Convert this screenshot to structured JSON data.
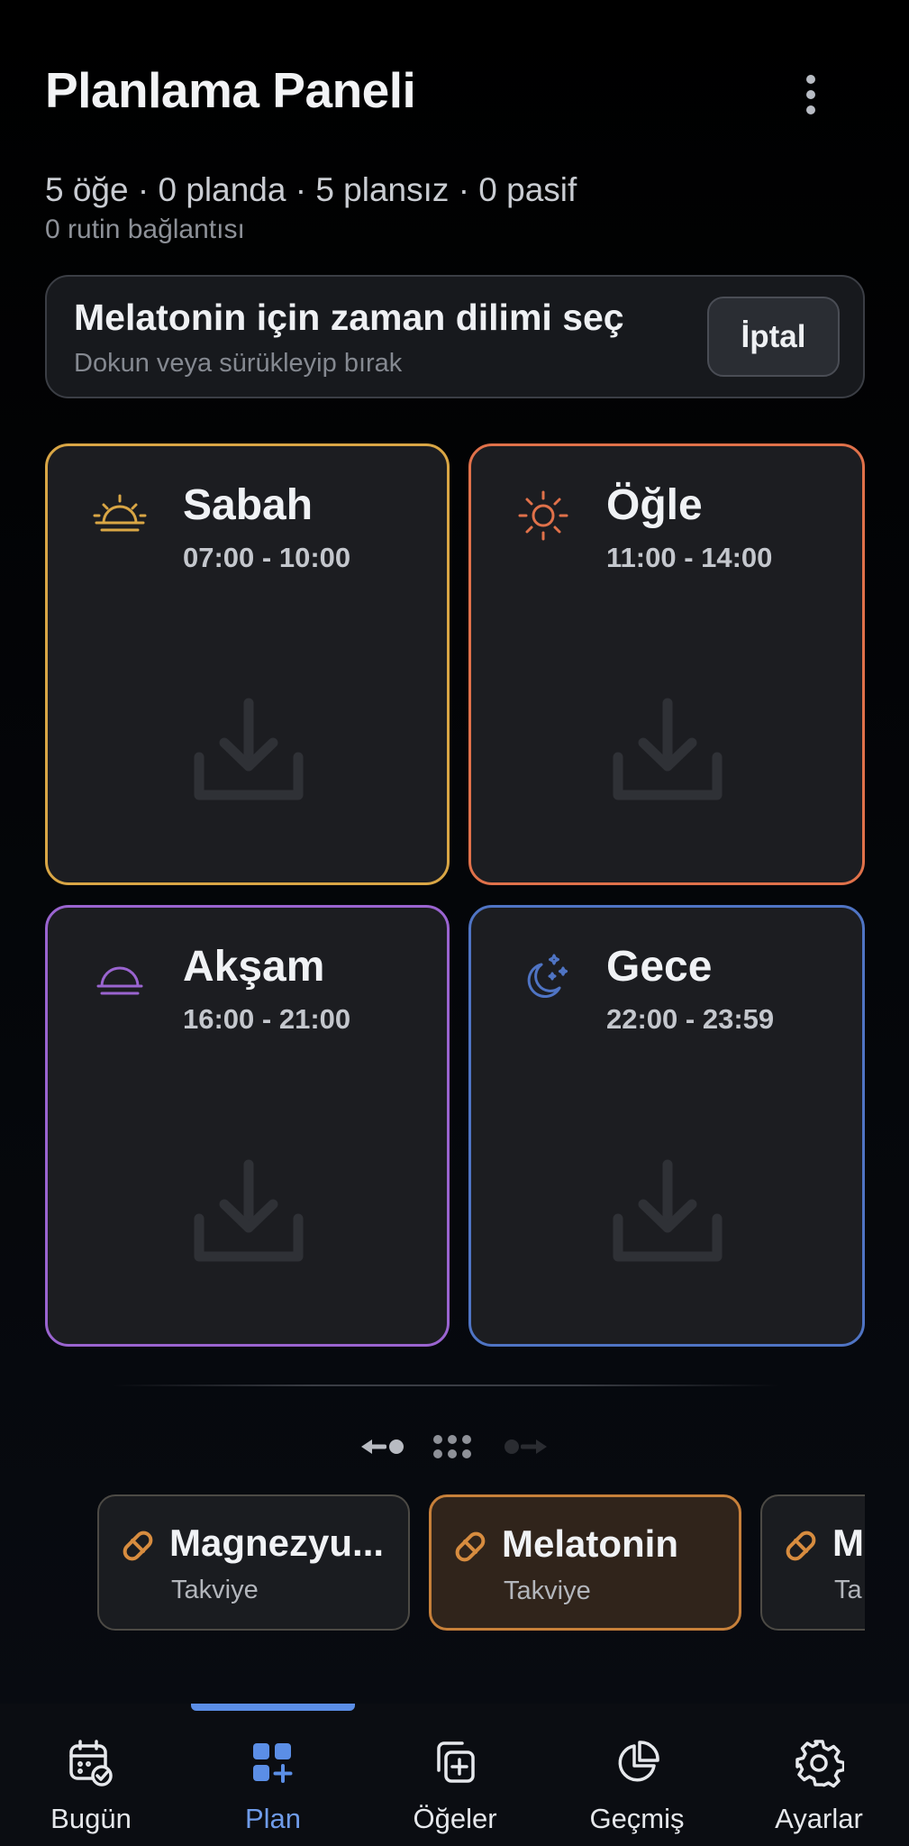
{
  "header": {
    "title": "Planlama Paneli",
    "stats": "5 öğe · 0 planda · 5 plansız · 0 pasif",
    "substats": "0 rutin bağlantısı",
    "menu_icon": "more-vertical-icon"
  },
  "selection_banner": {
    "title": "Melatonin için zaman dilimi seç",
    "subtitle": "Dokun veya sürükleyip bırak",
    "cancel_label": "İptal"
  },
  "time_slots": [
    {
      "name": "Sabah",
      "time": "07:00 - 10:00",
      "icon": "sunrise-icon",
      "color": "#d9a645"
    },
    {
      "name": "Öğle",
      "time": "11:00 - 14:00",
      "icon": "sun-icon",
      "color": "#e0714a"
    },
    {
      "name": "Akşam",
      "time": "16:00 - 21:00",
      "icon": "sunset-icon",
      "color": "#9a64d0"
    },
    {
      "name": "Gece",
      "time": "22:00 - 23:59",
      "icon": "moon-stars-icon",
      "color": "#4f74c4"
    }
  ],
  "items": [
    {
      "name": "Magnezyu...",
      "category": "Takviye",
      "icon": "pill-icon",
      "selected": false
    },
    {
      "name": "Melatonin",
      "category": "Takviye",
      "icon": "pill-icon",
      "selected": true
    },
    {
      "name": "M",
      "category": "Ta",
      "icon": "pill-icon",
      "selected": false
    }
  ],
  "bottom_nav": [
    {
      "label": "Bugün",
      "icon": "calendar-check-icon",
      "active": false
    },
    {
      "label": "Plan",
      "icon": "grid-plus-icon",
      "active": true
    },
    {
      "label": "Öğeler",
      "icon": "copy-plus-icon",
      "active": false
    },
    {
      "label": "Geçmiş",
      "icon": "pie-chart-icon",
      "active": false
    },
    {
      "label": "Ayarlar",
      "icon": "settings-icon",
      "active": false
    }
  ],
  "colors": {
    "accent": "#5b8ee6",
    "selected_item_border": "#c7803a"
  }
}
